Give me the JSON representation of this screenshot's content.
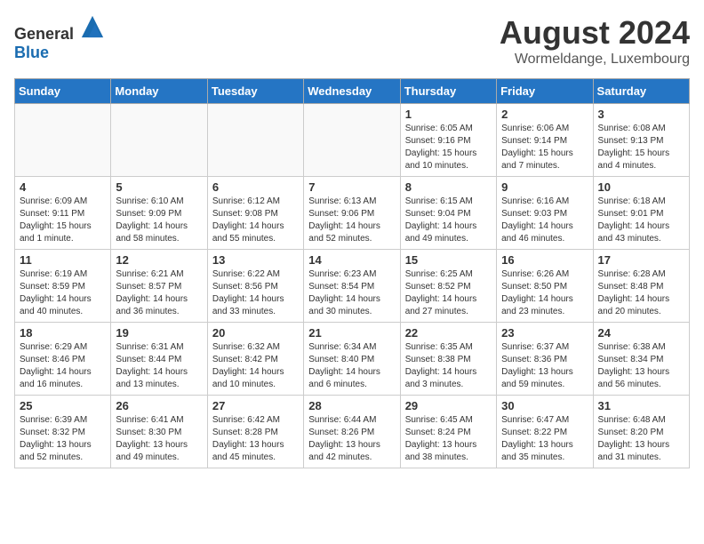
{
  "header": {
    "logo_general": "General",
    "logo_blue": "Blue",
    "month": "August 2024",
    "location": "Wormeldange, Luxembourg"
  },
  "days_of_week": [
    "Sunday",
    "Monday",
    "Tuesday",
    "Wednesday",
    "Thursday",
    "Friday",
    "Saturday"
  ],
  "weeks": [
    [
      {
        "day": "",
        "info": ""
      },
      {
        "day": "",
        "info": ""
      },
      {
        "day": "",
        "info": ""
      },
      {
        "day": "",
        "info": ""
      },
      {
        "day": "1",
        "info": "Sunrise: 6:05 AM\nSunset: 9:16 PM\nDaylight: 15 hours\nand 10 minutes."
      },
      {
        "day": "2",
        "info": "Sunrise: 6:06 AM\nSunset: 9:14 PM\nDaylight: 15 hours\nand 7 minutes."
      },
      {
        "day": "3",
        "info": "Sunrise: 6:08 AM\nSunset: 9:13 PM\nDaylight: 15 hours\nand 4 minutes."
      }
    ],
    [
      {
        "day": "4",
        "info": "Sunrise: 6:09 AM\nSunset: 9:11 PM\nDaylight: 15 hours\nand 1 minute."
      },
      {
        "day": "5",
        "info": "Sunrise: 6:10 AM\nSunset: 9:09 PM\nDaylight: 14 hours\nand 58 minutes."
      },
      {
        "day": "6",
        "info": "Sunrise: 6:12 AM\nSunset: 9:08 PM\nDaylight: 14 hours\nand 55 minutes."
      },
      {
        "day": "7",
        "info": "Sunrise: 6:13 AM\nSunset: 9:06 PM\nDaylight: 14 hours\nand 52 minutes."
      },
      {
        "day": "8",
        "info": "Sunrise: 6:15 AM\nSunset: 9:04 PM\nDaylight: 14 hours\nand 49 minutes."
      },
      {
        "day": "9",
        "info": "Sunrise: 6:16 AM\nSunset: 9:03 PM\nDaylight: 14 hours\nand 46 minutes."
      },
      {
        "day": "10",
        "info": "Sunrise: 6:18 AM\nSunset: 9:01 PM\nDaylight: 14 hours\nand 43 minutes."
      }
    ],
    [
      {
        "day": "11",
        "info": "Sunrise: 6:19 AM\nSunset: 8:59 PM\nDaylight: 14 hours\nand 40 minutes."
      },
      {
        "day": "12",
        "info": "Sunrise: 6:21 AM\nSunset: 8:57 PM\nDaylight: 14 hours\nand 36 minutes."
      },
      {
        "day": "13",
        "info": "Sunrise: 6:22 AM\nSunset: 8:56 PM\nDaylight: 14 hours\nand 33 minutes."
      },
      {
        "day": "14",
        "info": "Sunrise: 6:23 AM\nSunset: 8:54 PM\nDaylight: 14 hours\nand 30 minutes."
      },
      {
        "day": "15",
        "info": "Sunrise: 6:25 AM\nSunset: 8:52 PM\nDaylight: 14 hours\nand 27 minutes."
      },
      {
        "day": "16",
        "info": "Sunrise: 6:26 AM\nSunset: 8:50 PM\nDaylight: 14 hours\nand 23 minutes."
      },
      {
        "day": "17",
        "info": "Sunrise: 6:28 AM\nSunset: 8:48 PM\nDaylight: 14 hours\nand 20 minutes."
      }
    ],
    [
      {
        "day": "18",
        "info": "Sunrise: 6:29 AM\nSunset: 8:46 PM\nDaylight: 14 hours\nand 16 minutes."
      },
      {
        "day": "19",
        "info": "Sunrise: 6:31 AM\nSunset: 8:44 PM\nDaylight: 14 hours\nand 13 minutes."
      },
      {
        "day": "20",
        "info": "Sunrise: 6:32 AM\nSunset: 8:42 PM\nDaylight: 14 hours\nand 10 minutes."
      },
      {
        "day": "21",
        "info": "Sunrise: 6:34 AM\nSunset: 8:40 PM\nDaylight: 14 hours\nand 6 minutes."
      },
      {
        "day": "22",
        "info": "Sunrise: 6:35 AM\nSunset: 8:38 PM\nDaylight: 14 hours\nand 3 minutes."
      },
      {
        "day": "23",
        "info": "Sunrise: 6:37 AM\nSunset: 8:36 PM\nDaylight: 13 hours\nand 59 minutes."
      },
      {
        "day": "24",
        "info": "Sunrise: 6:38 AM\nSunset: 8:34 PM\nDaylight: 13 hours\nand 56 minutes."
      }
    ],
    [
      {
        "day": "25",
        "info": "Sunrise: 6:39 AM\nSunset: 8:32 PM\nDaylight: 13 hours\nand 52 minutes."
      },
      {
        "day": "26",
        "info": "Sunrise: 6:41 AM\nSunset: 8:30 PM\nDaylight: 13 hours\nand 49 minutes."
      },
      {
        "day": "27",
        "info": "Sunrise: 6:42 AM\nSunset: 8:28 PM\nDaylight: 13 hours\nand 45 minutes."
      },
      {
        "day": "28",
        "info": "Sunrise: 6:44 AM\nSunset: 8:26 PM\nDaylight: 13 hours\nand 42 minutes."
      },
      {
        "day": "29",
        "info": "Sunrise: 6:45 AM\nSunset: 8:24 PM\nDaylight: 13 hours\nand 38 minutes."
      },
      {
        "day": "30",
        "info": "Sunrise: 6:47 AM\nSunset: 8:22 PM\nDaylight: 13 hours\nand 35 minutes."
      },
      {
        "day": "31",
        "info": "Sunrise: 6:48 AM\nSunset: 8:20 PM\nDaylight: 13 hours\nand 31 minutes."
      }
    ]
  ]
}
